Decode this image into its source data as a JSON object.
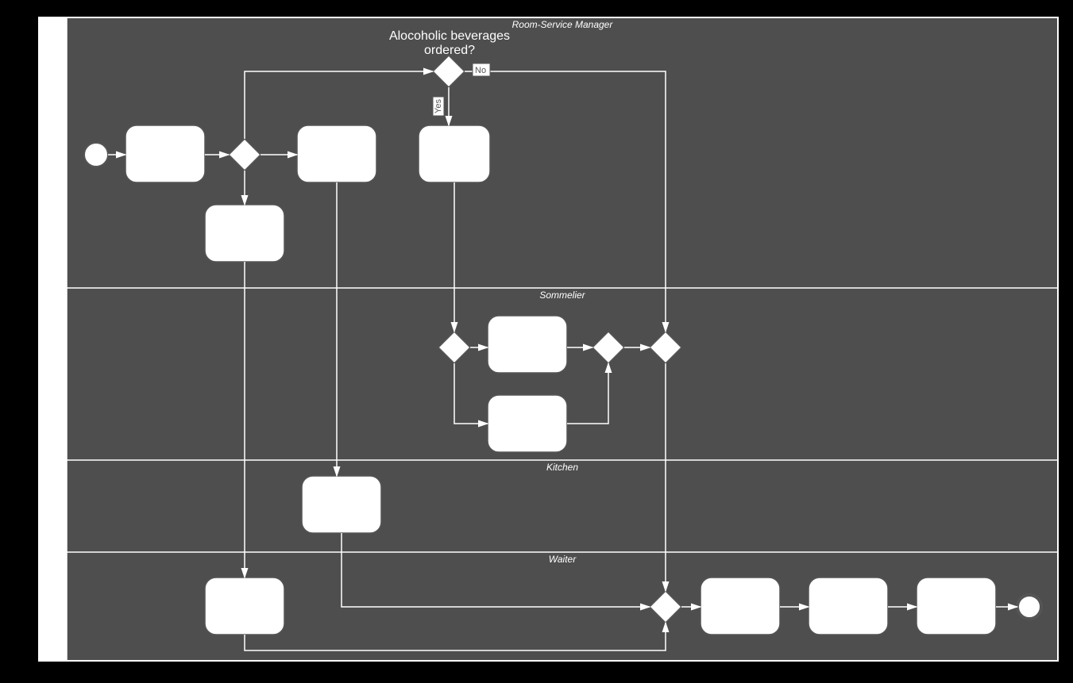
{
  "pool": {
    "title": "Room-Service Manager",
    "lanes": [
      {
        "id": "rsm",
        "label": "Room-Service Manager",
        "title": "Room-Service Manager"
      },
      {
        "id": "som",
        "label": "Sommelier",
        "title": "Sommelier"
      },
      {
        "id": "kit",
        "label": "Kitchen",
        "title": "Kitchen"
      },
      {
        "id": "wai",
        "label": "Waiter",
        "title": "Waiter"
      }
    ]
  },
  "gateway_question": {
    "line1": "Alocoholic beverages",
    "line2": "ordered?"
  },
  "edge_labels": {
    "no": "No",
    "yes": "Yes"
  }
}
